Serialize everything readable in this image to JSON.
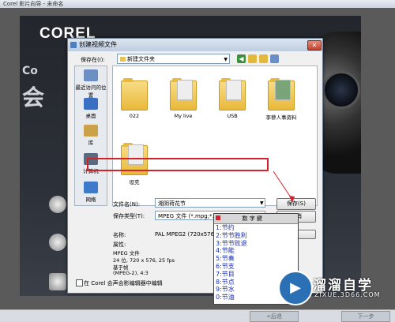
{
  "app": {
    "title": "Corel 影片向导 - 未命名",
    "logo": "COREL",
    "side_letter": "Co",
    "side_big": "会",
    "prev_label": "<后退",
    "next_label": "下一步"
  },
  "dialog": {
    "title": "创建视频文件",
    "close_label": "✕",
    "save_in_label": "保存在(I):",
    "save_in_value": "新建文件夹",
    "places": [
      {
        "label": "最近访问的位置",
        "icon": "recent-icon",
        "color": "#6b8fc2"
      },
      {
        "label": "桌面",
        "icon": "desktop-icon",
        "color": "#3a6fc4"
      },
      {
        "label": "库",
        "icon": "library-icon",
        "color": "#c9a24a"
      },
      {
        "label": "计算机",
        "icon": "computer-icon",
        "color": "#5a6b80"
      },
      {
        "label": "网络",
        "icon": "network-icon",
        "color": "#3d7ac9"
      }
    ],
    "folders": [
      {
        "label": "022"
      },
      {
        "label": "My live"
      },
      {
        "label": "USB"
      },
      {
        "label": "李蓼人事资料"
      },
      {
        "label": "坦克"
      }
    ],
    "filename_label": "文件名(N):",
    "filename_value": "湘阴荷花节",
    "filetype_label": "保存类型(T):",
    "filetype_value": "MPEG 文件 (*.mpg;*.m2t)",
    "save_button": "保存(S)",
    "cancel_button": "取消",
    "name_label": "名称:",
    "name_value": "PAL    MPEG2 (720x576",
    "props_label": "属性:",
    "props_lines": [
      "MPEG 文件",
      "24 位, 720 x 576, 25 fps",
      "基于帧",
      "(MPEG-2), 4:3"
    ],
    "checkbox_label": "在 Corel 会声会影编辑器中编辑"
  },
  "ime": {
    "title": "数 字 鍵",
    "items": [
      {
        "num": "1",
        "text": "节约"
      },
      {
        "num": "2",
        "text": "节节胜利"
      },
      {
        "num": "3",
        "text": "节节败退"
      },
      {
        "num": "4",
        "text": "节能"
      },
      {
        "num": "5",
        "text": "节奏"
      },
      {
        "num": "6",
        "text": "节支"
      },
      {
        "num": "7",
        "text": "节目"
      },
      {
        "num": "8",
        "text": "节点"
      },
      {
        "num": "9",
        "text": "节水"
      },
      {
        "num": "0",
        "text": "节油"
      }
    ]
  },
  "watermark": {
    "text": "溜溜自学",
    "url": "ZIXUE.3D66.COM",
    "icon": "play-icon"
  },
  "colors": {
    "highlight": "#d2232a",
    "ime_text": "#1a2fb0"
  }
}
